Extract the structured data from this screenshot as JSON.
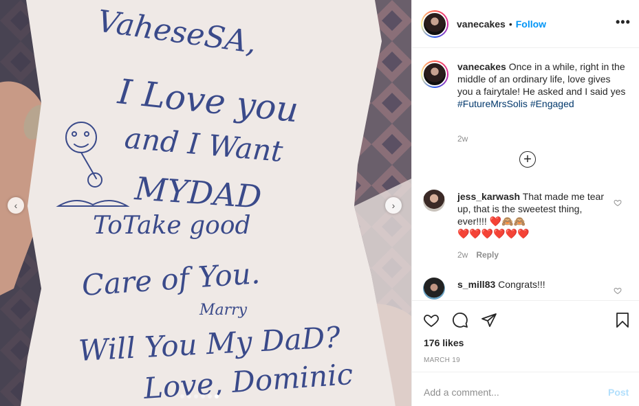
{
  "post": {
    "photo_alt": "Handwritten letter held in hand",
    "letter_lines": [
      "VaheseSA,",
      "I Love you",
      "and I Want",
      "MYDAD",
      "ToTake good",
      "Care of You.",
      "Marry",
      "Will You My DaD?",
      "Love, Dominic"
    ],
    "carousel_dots": 6,
    "active_dot": 5
  },
  "header": {
    "username": "vanecakes",
    "separator": "•",
    "follow_label": "Follow",
    "more_label": "•••"
  },
  "caption": {
    "username": "vanecakes",
    "text": "Once in a while, right in the middle of an ordinary life, love gives you a fairytale! He asked and I said yes",
    "hashtag1": "#FutureMrsSolis",
    "hashtag2": "#Engaged",
    "time": "2w"
  },
  "load_more_label": "+",
  "comments": [
    {
      "username": "jess_karwash",
      "text": "That made me tear up, that is the sweetest thing, ever!!!!",
      "emoji1": "❤️🙈🙈",
      "emoji2": "❤️❤️❤️❤️❤️❤️",
      "time": "2w",
      "reply_label": "Reply"
    },
    {
      "username": "s_mill83",
      "text": "Congrats!!!"
    }
  ],
  "actions": {
    "likes": "176 likes",
    "date": "MARCH 19"
  },
  "add_comment": {
    "placeholder": "Add a comment...",
    "post_label": "Post"
  },
  "colors": {
    "link_blue": "#0095f6",
    "hashtag": "#00376b",
    "muted": "#8e8e8e",
    "post_disabled": "#b2dffc"
  },
  "icons": [
    "chevron-left-icon",
    "chevron-right-icon",
    "more-icon",
    "plus-circle-icon",
    "heart-icon",
    "comment-icon",
    "share-icon",
    "bookmark-icon"
  ]
}
